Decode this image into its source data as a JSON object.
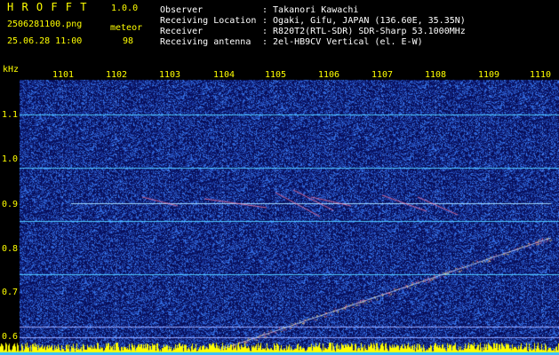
{
  "header": {
    "app_name": "H R O F F T",
    "version": "1.0.0",
    "filename": "2506281100.png",
    "datetime": "25.06.28 11:00",
    "detection_label": "meteor",
    "detection_count": "98",
    "fields": [
      {
        "label": "Observer",
        "value": ": Takanori Kawachi"
      },
      {
        "label": "Receiving Location",
        "value": ": Ogaki, Gifu, JAPAN (136.60E, 35.35N)"
      },
      {
        "label": "Receiver",
        "value": ": R820T2(RTL-SDR) SDR-Sharp 53.1000MHz"
      },
      {
        "label": "Receiving antenna",
        "value": ": 2el-HB9CV Vertical (el. E-W)"
      }
    ]
  },
  "chart_data": {
    "type": "heatmap",
    "ylabel": "kHz",
    "x_ticks": [
      "1101",
      "1102",
      "1103",
      "1104",
      "1105",
      "1106",
      "1107",
      "1108",
      "1109",
      "1110"
    ],
    "y_ticks": [
      "1.1",
      "1.0",
      "0.9",
      "0.8",
      "0.7",
      "0.6"
    ],
    "y_range": [
      0.58,
      1.18
    ],
    "colors": {
      "background": "#0a0a5a",
      "noise": "#2a40c0",
      "carrier": "#4fc8ff",
      "bottom_band": "#ffff00"
    }
  }
}
